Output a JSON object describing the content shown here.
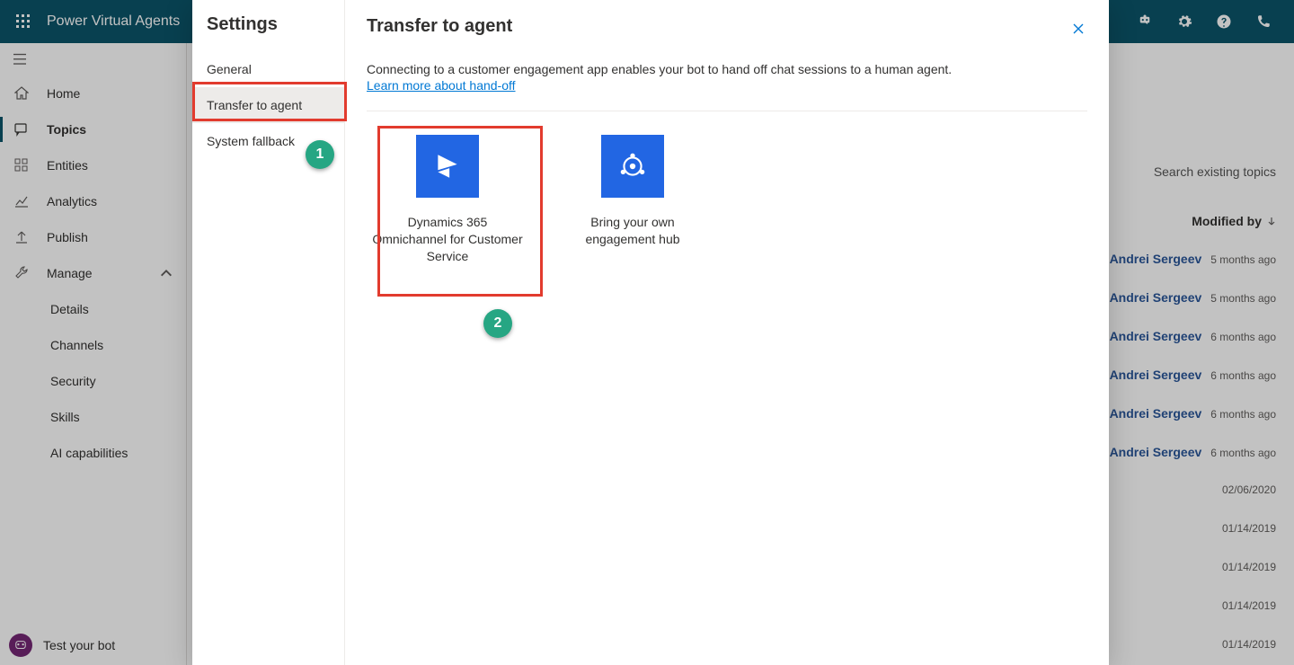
{
  "appbar": {
    "title": "Power Virtual Agents"
  },
  "nav": {
    "home": "Home",
    "topics": "Topics",
    "entities": "Entities",
    "analytics": "Analytics",
    "publish": "Publish",
    "manage": "Manage",
    "details": "Details",
    "channels": "Channels",
    "security": "Security",
    "skills": "Skills",
    "ai": "AI capabilities",
    "testbot": "Test your bot"
  },
  "bg": {
    "search_placeholder": "Search existing topics",
    "col_modified_by": "Modified by",
    "rows": [
      {
        "name": "Andrei Sergeev",
        "time": "5 months ago"
      },
      {
        "name": "Andrei Sergeev",
        "time": "5 months ago"
      },
      {
        "name": "Andrei Sergeev",
        "time": "6 months ago"
      },
      {
        "name": "Andrei Sergeev",
        "time": "6 months ago"
      },
      {
        "name": "Andrei Sergeev",
        "time": "6 months ago"
      },
      {
        "name": "Andrei Sergeev",
        "time": "6 months ago"
      },
      {
        "name": "",
        "time": "02/06/2020"
      },
      {
        "name": "",
        "time": "01/14/2019"
      },
      {
        "name": "",
        "time": "01/14/2019"
      },
      {
        "name": "",
        "time": "01/14/2019"
      },
      {
        "name": "",
        "time": "01/14/2019"
      }
    ]
  },
  "panel": {
    "side_title": "Settings",
    "tabs": {
      "general": "General",
      "transfer": "Transfer to agent",
      "fallback": "System fallback"
    },
    "title": "Transfer to agent",
    "desc": "Connecting to a customer engagement app enables your bot to hand off chat sessions to a human agent.",
    "link": "Learn more about hand-off",
    "cards": {
      "d365": "Dynamics 365 Omnichannel for Customer Service",
      "byo": "Bring your own engagement hub"
    }
  },
  "annotations": {
    "b1": "1",
    "b2": "2"
  }
}
